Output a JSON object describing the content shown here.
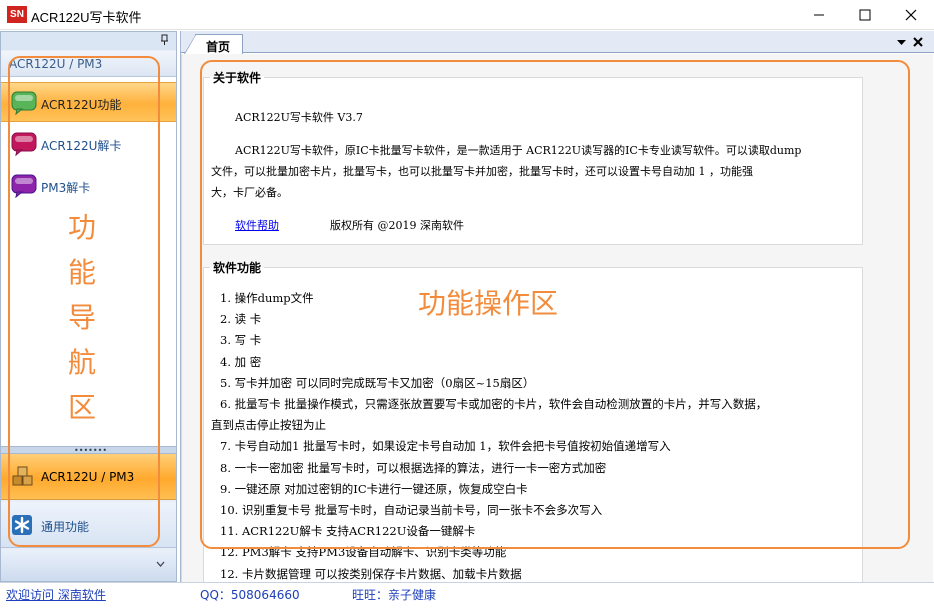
{
  "window": {
    "app_icon_text": "SN",
    "title": "ACR122U写卡软件"
  },
  "nav": {
    "group_title": "ACR122U / PM3",
    "items": [
      {
        "label": "ACR122U功能",
        "icon": "chat-bubble-icon",
        "color": "#4caf50",
        "active": true
      },
      {
        "label": "ACR122U解卡",
        "icon": "chat-bubble-icon",
        "color": "#c2185b",
        "active": false
      },
      {
        "label": "PM3解卡",
        "icon": "chat-bubble-icon",
        "color": "#8e24aa",
        "active": false
      }
    ],
    "sections": [
      {
        "label": "ACR122U / PM3",
        "icon": "cubes-icon",
        "active": true
      },
      {
        "label": "通用功能",
        "icon": "asterisk-icon",
        "active": false
      }
    ],
    "annotation": [
      "功",
      "能",
      "导",
      "航",
      "区"
    ]
  },
  "tabs": [
    {
      "label": "首页",
      "active": true
    }
  ],
  "about": {
    "legend": "关于软件",
    "version_line": "ACR122U写卡软件  V3.7",
    "desc_line1": "ACR122U写卡软件，原IC卡批量写卡软件，是一款适用于 ACR122U读写器的IC卡专业读写软件。可以读取dump",
    "desc_line2": "文件，可以批量加密卡片，批量写卡，也可以批量写卡并加密，批量写卡时，还可以设置卡号自动加 1 ，功能强",
    "desc_line3": "大，卡厂必备。",
    "help_link": "软件帮助",
    "copyright": "版权所有 @2019 深南软件"
  },
  "features": {
    "legend": "软件功能",
    "annotation": "功能操作区",
    "lines": [
      "1.  操作dump文件",
      "2.  读  卡",
      "3.  写  卡",
      "4.  加  密",
      "5.  写卡并加密    可以同时完成既写卡又加密（0扇区~15扇区）",
      "6.  批量写卡      批量操作模式，只需逐张放置要写卡或加密的卡片，软件会自动检测放置的卡片，并写入数据，",
      "直到点击停止按钮为止",
      "7.  卡号自动加1   批量写卡时，如果设定卡号自动加 1，软件会把卡号值按初始值递增写入",
      "8.  一卡一密加密  批量写卡时，可以根据选择的算法，进行一卡一密方式加密",
      "9.  一键还原      对加过密钥的IC卡进行一键还原，恢复成空白卡",
      "10. 识别重复卡号  批量写卡时，自动记录当前卡号，同一张卡不会多次写入",
      "11. ACR122U解卡   支持ACR122U设备一键解卡",
      "12. PM3解卡       支持PM3设备自动解卡、识别卡类等功能",
      "12. 卡片数据管理  可以按类别保存卡片数据、加载卡片数据"
    ]
  },
  "status": {
    "link": "欢迎访问 深南软件",
    "qq": "QQ：508064660",
    "wangwang": "旺旺：亲子健康"
  },
  "colors": {
    "annotation": "#f28c3c",
    "active_orange": "#ffb13c",
    "app_icon": "#d2241f"
  }
}
